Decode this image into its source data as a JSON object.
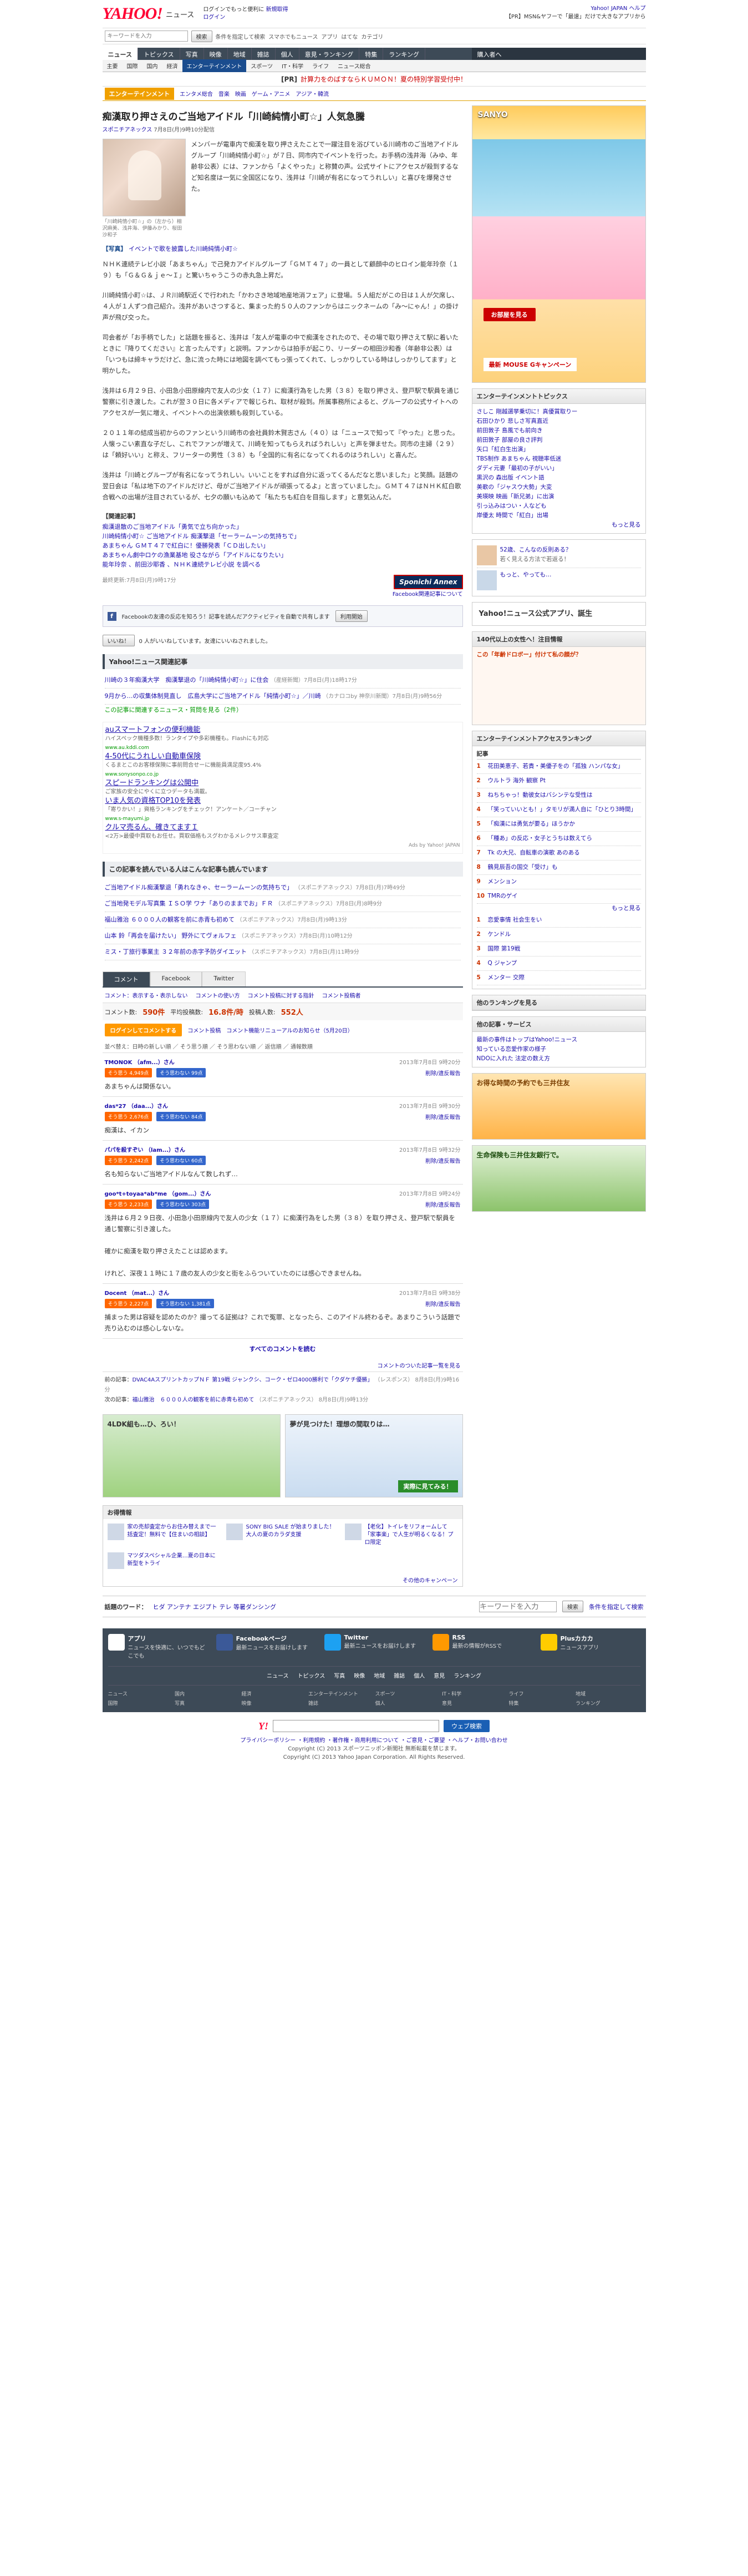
{
  "header": {
    "logo": "YAHOO!",
    "logo_sub": "ニュース",
    "msg1": "ログインでもっと便利に",
    "msg_link": "新規取得",
    "login": "ログイン",
    "right_top": "Yahoo! JAPAN ヘルプ",
    "right_sub": "【PR】MSN&ヤフーで「最速」だけで大きなアプリから"
  },
  "search": {
    "placeholder": "キーワードを入力",
    "button": "検索",
    "note": "条件を指定して検索",
    "links": [
      "スマホでもニュース",
      "アプリ",
      "はてな",
      "カテゴリ"
    ]
  },
  "nav1": {
    "items": [
      "ニュース",
      "トピックス",
      "写真",
      "映像",
      "地域",
      "雑誌",
      "個人",
      "意見・ランキング",
      "特集",
      "ランキング"
    ],
    "right": "購入者へ"
  },
  "nav2": {
    "items": [
      "主要",
      "国際",
      "国内",
      "経済",
      "エンターテインメント",
      "スポーツ",
      "IT・科学",
      "ライフ",
      "ニュース総合"
    ],
    "active": 4
  },
  "pr": {
    "tag": "[PR]",
    "text": "計算力をのばすならＫＵＭＯＮ！夏の特別学習受付中！"
  },
  "catbar": {
    "tag": "エンターテインメント",
    "items": [
      "エンタメ総合",
      "音楽",
      "映画",
      "ゲーム・アニメ",
      "アジア・韓流"
    ]
  },
  "article": {
    "title": "痴漢取り押さえのご当地アイドル「川崎純情小町☆」人気急騰",
    "source": "スポニチアネックス",
    "date": "7月8日(月)9時10分配信",
    "caption": "「川崎純情小町☆」の（左から）相沢麻美、浅井海、伊藤みかり、桜田沙和子",
    "p1": "メンバーが電車内で痴漢を取り押さえたことで一躍注目を浴びている川崎市のご当地アイドルグループ「川崎純情小町☆」が７日、同市内でイベントを行った。お手柄の浅井海（みゆ、年齢非公表）には、ファンから「よくやった」と称賛の声。公式サイトにアクセスが殺到するなど知名度は一気に全国区になり、浅井は「川崎が有名になってうれしい」と喜びを爆発させた。",
    "photolink_label": "【写真】",
    "photolink": "イベントで歌を披露した川崎純情小町☆",
    "p2": "ＮＨＫ連続テレビ小説「あまちゃん」で己発カアイドルグループ「ＧＭＴ４７」の一員として顧顔中のヒロイン能年玲奈（１９）も「Ｇ＆Ｇ＆ｊｅ～Ｉ」と驚いちゃうこうの赤丸急上昇だ。",
    "p3": "川崎純情小町☆は、ＪＲ川崎駅近くで行われた「かわさき地域地産地消フェア」に登場。５人組だがこの日は１人が欠席し、４人が１人ずつ自己紹介。浅井があいさつすると、集まった約５０人のファンからはニックネームの「み～にゃん！」の掛け声が飛び交った。",
    "p4": "司会者が「お手柄でした」と話題を振ると、浅井は「友人が電車の中で痴漢をされたので、その場で取り押さえて駅に着いたときに『降りてください』と言ったんです」と説明。ファンからは拍手が起こり、リーダーの相田沙和香（年齢非公表）は「いつもは締キャラだけど、急に流った時には地図を調べてもっ張ってくれて、しっかりしている時はしっかりしてます」と明かした。",
    "p5": "浅井は６月２９日、小田急小田原線内で友人の少女（１７）に痴漢行為をした男（３８）を取り押さえ、登戸駅で駅員を通じ警察に引き渡した。これが翌３０日に各メディアで報じられ、取材が殺到。所属事務所によると、グループの公式サイトへのアクセスが一気に増え、イベントへの出演依頼も殺到している。",
    "p6": "２０１１年の結成当初からのファンという川崎市の会社員鈴木賢志さん（４０）は「ニュースで知って『やった』と思った。人懐っこい素直な子だし、これでファンが増えて、川崎を知ってもらえればうれしい」と声を弾ませた。同市の主婦（２９）は「頼好いい」と称え、フリーターの男性（３８）も「全国的に有名になってくれるのはうれしい」と喜んだ。",
    "p7": "浅井は「川崎とグループが有名になってうれしい。いいことをすれば自分に返ってくるんだなと思いました」と笑顔。話題の翌日会は「私は地下のアイドルだけど、母がご当地アイドルが頑張ってるよ」と言っていました」。ＧＭＴ４７はＮＨＫ紅白歌合戦への出場が注目されているが、七夕の願いも込めて「私たちも紅白を目指します」と意気込んだ。",
    "related_hd": "【関連記事】",
    "related": [
      "痴漢退散のご当地アイドル「勇気で立ち向かった」",
      "川崎純情小町☆ ご当地アイドル 痴漢撃退「セーラームーンの気持ちで」",
      "あまちゃん ＧＭＴ４７で紅白に！優勝発表「ＣＤ出したい」",
      "あまちゃん劇中ロケの漁業基地 役さながら「アイドルになりたい」",
      "能年玲奈 、前田沙耶香 、ＮＨＫ連続テレビ小説 を調べる"
    ],
    "dateline": "最終更新:7月8日(月)9時17分",
    "brand": "Sponichi Annex",
    "fb_notice": "Facebook関連記事について",
    "fb_text": "Facebookの友達の反応を知ろう！記事を読んだアクティビティを自動で共有します",
    "fb_btn": "利用開始",
    "share": "いいね！",
    "share_note": "0 人がいいねしています。友達にいいねされました。"
  },
  "relnews": {
    "hd": "Yahoo!ニュース関連記事",
    "items": [
      {
        "t": "川崎の３年痴漢大学　痴漢撃退の「川崎純情小町☆」に住会",
        "s": "（産経新聞）7月8日(月)18時17分"
      },
      {
        "t": "9月から…の収集体制見直し　広島大学にご当地アイドル「純情小町☆」／川崎",
        "s": "（カナロコby 神奈川新聞）7月8日(月)9時56分"
      }
    ],
    "more": "この記事に関連するニュース・質問を見る（2件）"
  },
  "ads": [
    {
      "t": "auスマートフォンの便利機能",
      "d": "ハイスペック機種多数！ランタイプや多彩機種も。Flashにも対応",
      "u": "www.au.kddi.com"
    },
    {
      "t": "4-50代にうれしい自動車保険",
      "d": "くるまとこのお客様保険に事前問合せーに機能員満足度95.4%",
      "u": "www.sonysonpo.co.jp"
    },
    {
      "t": "スピードランキングは公開中",
      "d": "ご家族の安全にやくに立つデータも満載。",
      "u": ""
    },
    {
      "t": "いま人気の資格TOP10を発表",
      "d": "「寄りかい！」資格ランキングをチェック！アンケート／コーチャン",
      "u": "www.s-mayumi.jp"
    },
    {
      "t": "クルマ売るん、確きてますＩ",
      "d": "<2万>最優中買取もお任せ。買取価格もスグわかるメレクサス車査定",
      "u": ""
    }
  ],
  "ads_note": "Ads by Yahoo! JAPAN",
  "readers": {
    "hd": "この記事を読んでいる人はこんな記事も読んでいます",
    "items": [
      {
        "t": "ご当地アイドル痴漢撃退「勇れなきゃ、セーラームーンの気持ちで」",
        "s": "（スポニチアネックス）7月8日(月)7時49分"
      },
      {
        "t": "ご当地発モデル写真集 ＩＳＯ学 ワナ「ありのままでお」ＦＲ",
        "s": "（スポニチアネックス）7月8日(月)8時9分"
      },
      {
        "t": "福山雅治 ６０００人の観客を前に赤青も初めて",
        "s": "（スポニチアネックス）7月8日(月)9時13分"
      },
      {
        "t": "山本 鈴「再会を届けたい」 野外にてヴォルフェ",
        "s": "（スポニチアネックス）7月8日(月)10時12分"
      },
      {
        "t": "ミス・丁旅行事業主 ３２年前の赤字予防ダイエット",
        "s": "（スポニチアネックス）7月8日(月)11時9分"
      }
    ]
  },
  "comments": {
    "tabs": [
      "コメント",
      "Facebook",
      "Twitter"
    ],
    "bar": [
      "コメント：表示する・表示しない",
      "コメントの使い方",
      "コメント投稿に対する指針",
      "コメント投稿者"
    ],
    "count_label": "コメント数:",
    "count": "590件",
    "avg_label": "平均投稿数:",
    "avg": "16.8件/時",
    "posters_label": "投稿人数:",
    "posters": "552人",
    "login_btn": "ログインしてコメントする",
    "rule": "コメント投稿",
    "rule2": "コメント機能リニューアルのお知らせ（5月20日）",
    "sort": "並べ替え：日時の新しい順 ／ そう思う順 ／ そう思わない順 ／ 返信順 ／ 通報数順",
    "items": [
      {
        "name": "TMONOK （afm...）さん",
        "date": "2013年7月8日 9時20分",
        "agree": "そう思う 4,949点",
        "disagree": "そう思わない 99点",
        "report": "削除/違反報告",
        "text": "あまちゃんは関係ない。"
      },
      {
        "name": "das*27 （daa...）さん",
        "date": "2013年7月8日 9時30分",
        "agree": "そう思う 2,676点",
        "disagree": "そう思わない 84点",
        "report": "削除/違反報告",
        "text": "痴漢は、イカン"
      },
      {
        "name": "パパを殺すぞい （lam...）さん",
        "date": "2013年7月8日 9時32分",
        "agree": "そう思う 2,242点",
        "disagree": "そう思わない 60点",
        "report": "削除/違反報告",
        "text": "名も知らないご当地アイドルなんて数しれず…"
      },
      {
        "name": "goo*t+toyaa*ab*me （gom...）さん",
        "date": "2013年7月8日 9時24分",
        "agree": "そう思う 2,233点",
        "disagree": "そう思わない 303点",
        "report": "削除/違反報告",
        "text": "浅井は６月２９日夜、小田急小田原線内で友人の少女（１７）に痴漢行為をした男（３８）を取り押さえ、登戸駅で駅員を通じ警察に引き渡した。\n\n確かに痴漢を取り押さえたことは認めます。\n\nけれど、深夜１１時に１７歳の友人の少女と街をふらついていたのには感心できませんね。"
      },
      {
        "name": "Docent （mat...）さん",
        "date": "2013年7月8日 9時38分",
        "agree": "そう思う 2,227点",
        "disagree": "そう思わない 1,381点",
        "report": "削除/違反報告",
        "text": "捕まった男は容疑を認めたのか？撮ってる証拠は？これで冤罪、となったら、このアイドル終わるぞ。あまりこういう話題で売り込むのは感心しないな。"
      }
    ],
    "more": "すべてのコメントを読む",
    "others": "コメントのついた記事一覧を見る"
  },
  "prevnext": {
    "prev_label": "前の記事：",
    "prev": "DVAC4AスプリントカップＮＦ 第19戦  ジャンクシ、コーク・ゼロ4000勝利で「クダケチ優勝」",
    "prev_s": "（レスポンス） 8月8日(月)9時16分",
    "next_label": "次の記事：",
    "next": "福山雅治　６０００人の観客を前に赤青も初めて",
    "next_s": "（スポニチアネックス） 8月8日(月)9時13分"
  },
  "bigads": {
    "a": "4LDK組も…ひ、ろい！",
    "b": "夢が見つけた！理想の間取りは…",
    "c": "実際に見てみる！"
  },
  "promos": {
    "hd": "お得情報",
    "items": [
      "家の売却査定からお住み替えまで一括査定！無料で【住まいの相談】",
      "SONY BIG SALE が始まりました！大人の夏のカラダ支援",
      "【老化】トイレをリフォームして「家事楽」で人生が明るくなる！プロ限定",
      "マツダスペシャル企業…夏の日本に新型をトライ"
    ],
    "more": "その他のキャンペーン"
  },
  "keywords": {
    "label": "話題のワード：",
    "words": "ヒダ アンテナ エジプト テレ 等暑ダンシング",
    "placeholder": "キーワードを入力",
    "btn": "検索",
    "note": "条件を指定して検索"
  },
  "footer": {
    "apps": [
      {
        "t": "アプリ",
        "d": "ニュースを快適に、いつでもどこでも"
      },
      {
        "t": "Facebookページ",
        "d": "最新ニュースをお届けします"
      },
      {
        "t": "Twitter",
        "d": "最新ニュースをお届けします"
      },
      {
        "t": "RSS",
        "d": "最新の情報がRSSで"
      },
      {
        "t": "Plusカカカ",
        "d": "ニュースアプリ"
      }
    ],
    "links": [
      "ニュース",
      "トピックス",
      "写真",
      "映像",
      "地域",
      "雑誌",
      "個人",
      "意見",
      "ランキング"
    ],
    "grid": [
      "ニュース",
      "国内",
      "経済",
      "エンターテインメント",
      "スポーツ",
      "IT・科学",
      "ライフ",
      "地域",
      "国際",
      "写真",
      "映像",
      "雑誌",
      "個人",
      "意見",
      "特集",
      "ランキング"
    ]
  },
  "bottom": {
    "logo": "Y!",
    "btn": "ウェブ検索",
    "links": "プライバシーポリシー ・利用規約 ・著作権・商用利用について ・ご意見・ご要望 ・ヘルプ・お問い合わせ",
    "copy1": "Copyright (C) 2013 スポーツニッポン新聞社 無断転載を禁じます。",
    "copy2": "Copyright (C) 2013 Yahoo Japan Corporation. All Rights Reserved."
  },
  "side": {
    "ad_top": "SANYO",
    "ad_btn": "お部屋を見る",
    "ad_mouse": "最新 MOUSE Gキャンペーン",
    "topics_hd": "エンターテインメントトピックス",
    "topics": [
      "さしこ 剛越選挙乗切に！真優賞取りー",
      "石田ひかり 悲しさ写真直近",
      "前田敦子 島風でも前向き",
      "前田敦子 部屋の良さ評判",
      "矢口「紅白生出演」",
      "TBS制作 あまちゃん 視聴率低迷",
      "ダディ元妻「最初の子がいい」",
      "黒沢の 森出版 イベント語",
      "美歌の「ジャスウ大勢」大変",
      "美瑛映 映画「新兄弟」に出演",
      "引っ込みはつい・人なども",
      "岸優太 時間で「紅白」出場"
    ],
    "topics_more": "もっと見る",
    "pr1": "52歳、こんなの反則ある？",
    "pr1d": "若く見える方法で若返る！",
    "pr2": "もっと、やっても…",
    "pr2d": "",
    "fb_box": "Yahoo!ニュース公式アプリ、誕生",
    "ad2": "140代以上の女性へ！注目情報",
    "ad2t": "この「年齢ドロボー」付けて私の顔が？",
    "access_hd": "エンターテインメントアクセスランキング",
    "access_tab": "記事",
    "access": [
      "花田美恵子、若貴・美優子をの「孤独 ハンパな女」",
      "ウルトラ 海外 観察 Pt",
      "ねちちゃっ！動彼女はバシンテな受性は",
      "「笑っていいとも！」タモリが満人自に「ひとり3時間」",
      "「痴漢には勇気が要る」ほうかか",
      "「種あ」の反応・女子とうちは数えてら",
      "Tk の大兄、自転車の演歌 あのある",
      "鶴見辰吾の国交「受け」も",
      "メンション",
      "TMRのゲイ"
    ],
    "access_more": "もっと見る",
    "access2": [
      "恋愛事情 社会生をい",
      "ケンドル",
      "国際 第19戦",
      "Q ジャンプ",
      "メンター 交際"
    ],
    "service_hd": "他のランキングを見る",
    "service2_hd": "他の記事・サービス",
    "service2": [
      "最新の事件はトップはYahoo!ニュース",
      "知っている恋愛作家の様子",
      "NDOに入れた 法定の数え方"
    ],
    "ad3": "お得な時間の予約でも三井住友",
    "ad3b": "生命保険も三井住友銀行で。"
  }
}
